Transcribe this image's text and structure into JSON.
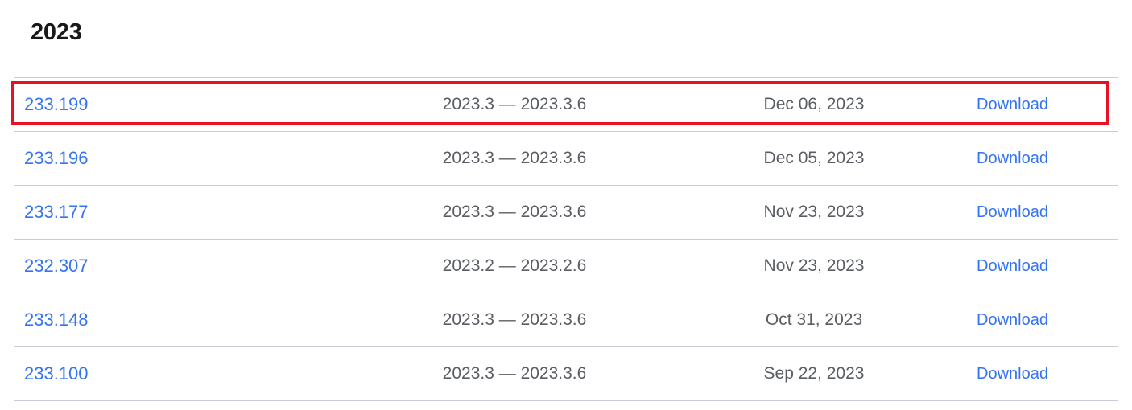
{
  "heading": {
    "year": "2023"
  },
  "colors": {
    "link": "#3574f0",
    "text_muted": "#5a5d63",
    "heading": "#19191c",
    "divider": "#c9ccd6",
    "highlight": "#e81123",
    "background": "#ffffff"
  },
  "table": {
    "download_label": "Download",
    "rows": [
      {
        "build": "233.199",
        "range": "2023.3 — 2023.3.6",
        "date": "Dec 06, 2023",
        "action": "Download",
        "highlighted": true
      },
      {
        "build": "233.196",
        "range": "2023.3 — 2023.3.6",
        "date": "Dec 05, 2023",
        "action": "Download",
        "highlighted": false
      },
      {
        "build": "233.177",
        "range": "2023.3 — 2023.3.6",
        "date": "Nov 23, 2023",
        "action": "Download",
        "highlighted": false
      },
      {
        "build": "232.307",
        "range": "2023.2 — 2023.2.6",
        "date": "Nov 23, 2023",
        "action": "Download",
        "highlighted": false
      },
      {
        "build": "233.148",
        "range": "2023.3 — 2023.3.6",
        "date": "Oct 31, 2023",
        "action": "Download",
        "highlighted": false
      },
      {
        "build": "233.100",
        "range": "2023.3 — 2023.3.6",
        "date": "Sep 22, 2023",
        "action": "Download",
        "highlighted": false
      }
    ]
  }
}
